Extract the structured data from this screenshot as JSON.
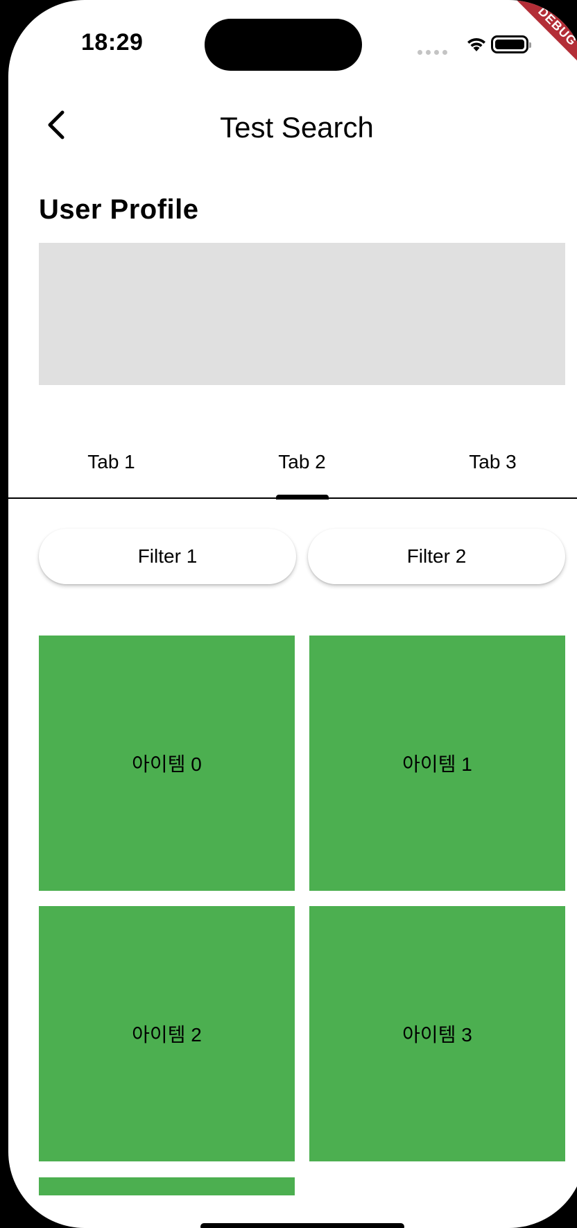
{
  "status_bar": {
    "time": "18:29"
  },
  "debug_banner": "DEBUG",
  "nav": {
    "title": "Test Search",
    "back_icon": "chevron-left-icon"
  },
  "profile": {
    "title": "User Profile"
  },
  "tabs": {
    "selected_index": 1,
    "items": [
      {
        "label": "Tab 1"
      },
      {
        "label": "Tab 2"
      },
      {
        "label": "Tab 3"
      }
    ]
  },
  "filters": [
    {
      "label": "Filter 1"
    },
    {
      "label": "Filter 2"
    }
  ],
  "grid": {
    "tile_color": "#4caf50",
    "items": [
      {
        "label": "아이템 0"
      },
      {
        "label": "아이템 1"
      },
      {
        "label": "아이템 2"
      },
      {
        "label": "아이템 3"
      }
    ]
  },
  "colors": {
    "placeholder": "#e0e0e0",
    "accent": "#000000",
    "debug": "#b32e37"
  }
}
